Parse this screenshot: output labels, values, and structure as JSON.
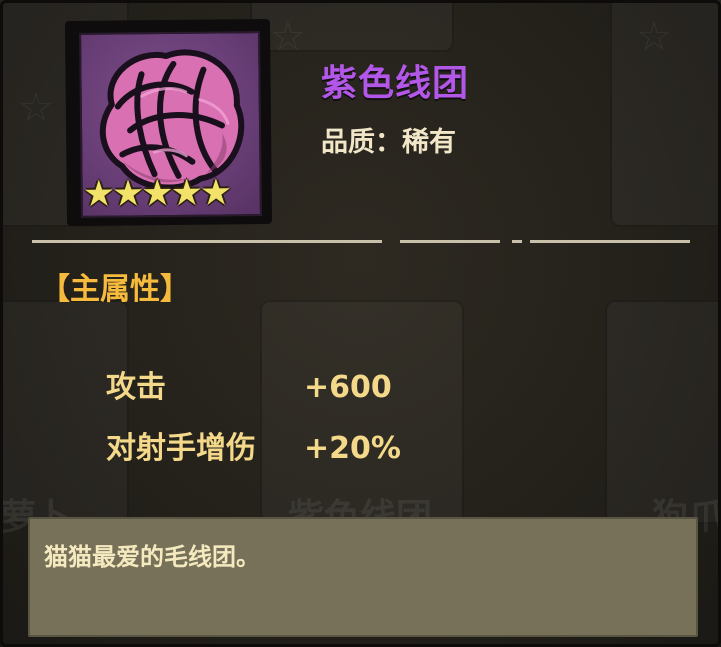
{
  "item": {
    "name": "紫色线团",
    "quality_label": "品质：",
    "quality_value": "稀有",
    "stars": 5,
    "name_color": "#b257e8",
    "icon": "purple-yarn-ball-icon"
  },
  "main_attributes": {
    "title": "【主属性】",
    "stats": [
      {
        "name": "攻击",
        "value": "+600"
      },
      {
        "name": "对射手增伤",
        "value": "+20%"
      }
    ]
  },
  "description": "猫猫最爱的毛线团。",
  "background": {
    "labels": [
      "萝卜",
      "紫色线团",
      "狗爪"
    ]
  }
}
